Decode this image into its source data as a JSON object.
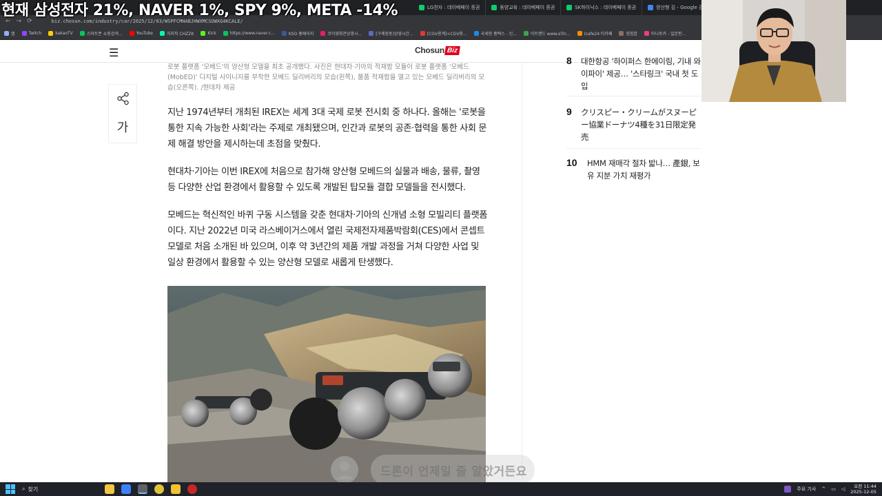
{
  "overlay": {
    "ticker": "현재 삼성전자 21%, NAVER 1%, SPY 9%, META -14%"
  },
  "browser": {
    "tabs": [
      {
        "label": "LG전자 : 데이베페이 증권",
        "color": "#0cce6b"
      },
      {
        "label": "동양교육 : 데이베페이 증권",
        "color": "#0cce6b"
      },
      {
        "label": "SK하이닉스 : 데이베페이 증권",
        "color": "#0cce6b"
      },
      {
        "label": "양산형 김 - Google 검색",
        "color": "#4285f4"
      }
    ],
    "url": "biz.chosun.com/industry/car/2025/12/03/WSPFCMHABJHWXMCSUWXG4KCALE/",
    "bookmarks": [
      {
        "label": "앱",
        "color": "#8ab4f8"
      },
      {
        "label": "Twitch",
        "color": "#9146ff"
      },
      {
        "label": "kakaoTV",
        "color": "#ffcd00"
      },
      {
        "label": "스마트폰 쇼핑검색...",
        "color": "#03c75a"
      },
      {
        "label": "YouTube",
        "color": "#ff0000"
      },
      {
        "label": "치지직 CHZZK",
        "color": "#00ffa3"
      },
      {
        "label": "Kick",
        "color": "#53fc18"
      },
      {
        "label": "https://www.naver.c...",
        "color": "#03c75a"
      },
      {
        "label": "KSO 홈페이지",
        "color": "#3b5998"
      },
      {
        "label": "코이영화관상영시...",
        "color": "#e91e63"
      },
      {
        "label": "[구례장동]상영시간...",
        "color": "#5c6bc0"
      },
      {
        "label": "[CGV용계]<CGV용...",
        "color": "#e53935"
      },
      {
        "label": "국세청 홈택스 - 신...",
        "color": "#1e88e5"
      },
      {
        "label": "이트렌드 www.eTrc...",
        "color": "#43a047"
      },
      {
        "label": "Icafe24 티카페",
        "color": "#fb8c00"
      },
      {
        "label": "힘힘합",
        "color": "#8d6e63"
      },
      {
        "label": "마나토카 - 일본판...",
        "color": "#ec407a"
      }
    ]
  },
  "site": {
    "logo_main": "Chosun",
    "logo_badge": "Biz",
    "menu_icon": "hamburger-icon"
  },
  "article": {
    "caption": "로봇 플랫폼 '모베드'의 양산형 모델을 최초 공개했다. 사진은 현대차·기아의 적재함 모듈이 로봇 플랫폼 '모베드 (MobED)' 디지털 사이니지를 부착한 모베드 딜리버리의 모습(왼쪽), 물품 적재함을 열고 있는 모베드 딜리버리의 모습(오른쪽). /현대차 제공",
    "font_button": "가",
    "paragraphs": [
      "지난 1974년부터 개최된 IREX는 세계 3대 국제 로봇 전시회 중 하나다. 올해는 '로봇을 통한 지속 가능한 사회'라는 주제로 개최됐으며, 인간과 로봇의 공존·협력을 통한 사회 문제 해결 방안을 제시하는데 초점을 맞췄다.",
      "현대차·기아는 이번 IREX에 처음으로 참가해 양산형 모베드의 실물과 배송, 물류, 촬영 등 다양한 산업 환경에서 활용할 수 있도록 개발된 탑모듈 결합 모델들을 전시했다.",
      "모베드는 혁신적인 바퀴 구동 시스템을 갖춘 현대차·기아의 신개념 소형 모빌리티 플랫폼이다. 지난 2022년 미국 라스베이거스에서 열린 국제전자제품박람회(CES)에서 콘셉트 모델로 처음 소개된 바 있으며, 이후 약 3년간의 제품 개발 과정을 거쳐 다양한 사업 및 일상 환경에서 활용할 수 있는 양산형 모델로 새롭게 탄생했다."
    ]
  },
  "ranking": [
    {
      "num": "8",
      "text": "대한항공 '하이퍼스 한에이링, 기내 와이파이' 제공… '스타링크' 국내 첫 도입"
    },
    {
      "num": "9",
      "text": "クリスピー・クリームがスヌーピー協業ドーナツ4種を31日限定発売"
    },
    {
      "num": "10",
      "text": "HMM 재매각 절차 밟나… 產銀, 보유 지분 가치 재평가"
    }
  ],
  "subtitle": {
    "text": "드론이 언제일 줄 알았거든요"
  },
  "taskbar": {
    "search_label": "찾기",
    "tray_label": "주요 기사",
    "time": "오전 11:44",
    "date": "2025-12-05"
  }
}
